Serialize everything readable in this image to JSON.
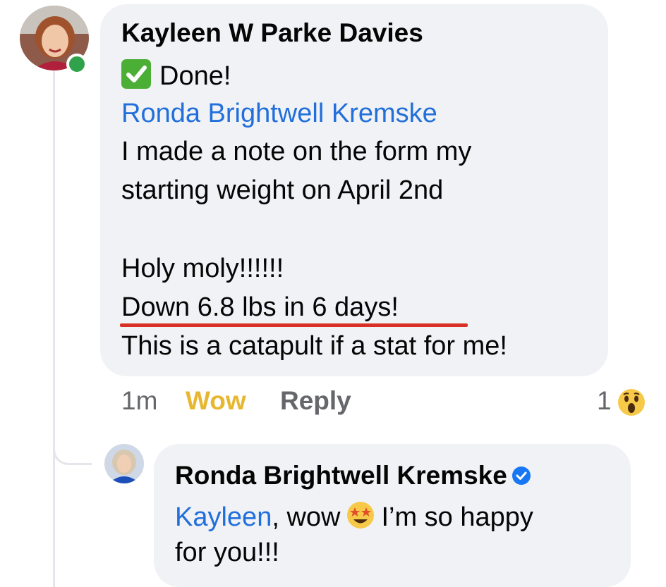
{
  "comment": {
    "author": "Kayleen W Parke Davies",
    "check_text": "Done!",
    "mention": "Ronda Brightwell Kremske",
    "body_line1": "I made a note on the form my",
    "body_line2": "starting weight on April 2nd",
    "body_line3": "Holy moly!!!!!!",
    "body_line4": "Down 6.8 lbs in 6 days!",
    "body_line5": "This is a catapult if a stat for me!",
    "time": "1m",
    "wow_label": "Wow",
    "reply_label": "Reply",
    "reaction_count": "1",
    "avatar_icon": "profile-photo",
    "status_icon": "online-dot-icon"
  },
  "reply": {
    "author": "Ronda Brightwell Kremske",
    "mention": "Kayleen",
    "text_after_mention": ", wow",
    "text_after_emoji": "I’m so happy",
    "text_line2": "for you!!!",
    "avatar_icon": "profile-photo",
    "verified_icon": "verified-badge-icon",
    "emoji_icon": "star-struck-emoji-icon"
  },
  "colors": {
    "bubble": "#f0f2f5",
    "mention": "#216fdb",
    "wow": "#e8b730",
    "underline": "#d93025",
    "online": "#31a24c",
    "meta": "#65676b"
  }
}
